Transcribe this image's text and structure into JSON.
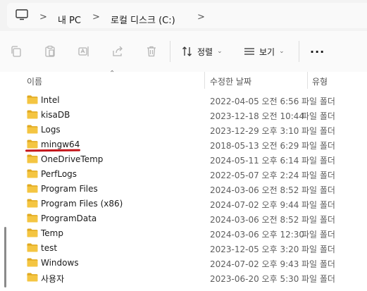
{
  "address": {
    "crumbs": [
      "내 PC",
      "로컬 디스크 (C:)"
    ],
    "chevron": ">"
  },
  "toolbar": {
    "icons": [
      "copy-icon",
      "paste-icon",
      "rename-icon",
      "share-icon",
      "delete-icon"
    ],
    "sort_label": "정렬",
    "view_label": "보기",
    "more_label": "···"
  },
  "columns": {
    "name": "이름",
    "modified": "수정한 날짜",
    "type": "유형"
  },
  "files": [
    {
      "name": "Intel",
      "modified": "2022-04-05 오전 6:56",
      "type": "파일 폴더"
    },
    {
      "name": "kisaDB",
      "modified": "2023-12-18 오전 10:44",
      "type": "파일 폴더"
    },
    {
      "name": "Logs",
      "modified": "2023-12-29 오후 3:10",
      "type": "파일 폴더"
    },
    {
      "name": "mingw64",
      "modified": "2018-05-13 오전 6:29",
      "type": "파일 폴더"
    },
    {
      "name": "OneDriveTemp",
      "modified": "2024-05-11 오후 6:14",
      "type": "파일 폴더"
    },
    {
      "name": "PerfLogs",
      "modified": "2022-05-07 오후 2:24",
      "type": "파일 폴더"
    },
    {
      "name": "Program Files",
      "modified": "2024-03-06 오전 8:52",
      "type": "파일 폴더"
    },
    {
      "name": "Program Files (x86)",
      "modified": "2024-07-02 오후 9:44",
      "type": "파일 폴더"
    },
    {
      "name": "ProgramData",
      "modified": "2024-03-06 오전 8:52",
      "type": "파일 폴더"
    },
    {
      "name": "Temp",
      "modified": "2024-03-06 오후 12:30",
      "type": "파일 폴더"
    },
    {
      "name": "test",
      "modified": "2023-12-05 오후 3:20",
      "type": "파일 폴더"
    },
    {
      "name": "Windows",
      "modified": "2024-07-02 오후 9:43",
      "type": "파일 폴더"
    },
    {
      "name": "사용자",
      "modified": "2023-06-20 오후 5:30",
      "type": "파일 폴더"
    }
  ],
  "colors": {
    "folder": "#f4c542",
    "folder_dark": "#e0a920",
    "annotation": "#c4151a"
  }
}
